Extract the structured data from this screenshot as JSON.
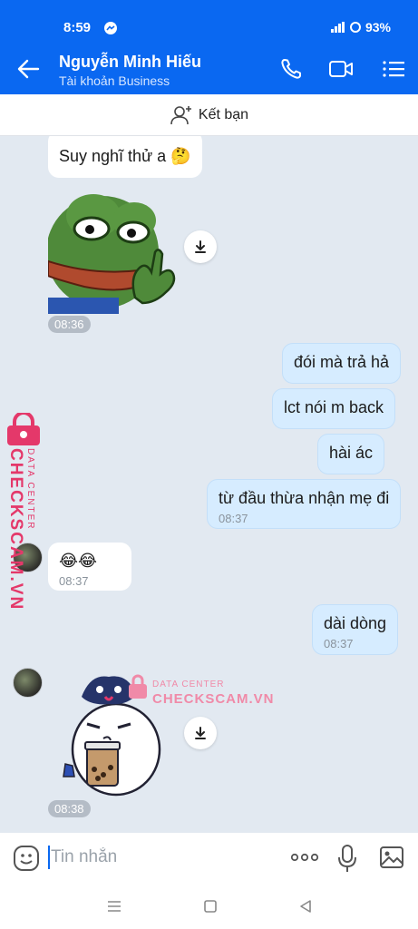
{
  "status": {
    "time": "8:59",
    "battery": "93%"
  },
  "header": {
    "name": "Nguyễn Minh Hiếu",
    "subtitle": "Tài khoản Business"
  },
  "add_friend": {
    "label": "Kết bạn"
  },
  "messages": {
    "m1": {
      "text": "Suy nghĩ thử a 🤔"
    },
    "sticker1": {
      "time": "08:36"
    },
    "m2": {
      "text": "đói mà trả hả"
    },
    "m3": {
      "text": "lct nói m back"
    },
    "m4": {
      "text": "hài ác"
    },
    "m5": {
      "text": "từ đầu thừa nhận mẹ đi",
      "time": "08:37"
    },
    "m6": {
      "text": "😂😂",
      "time": "08:37"
    },
    "m7": {
      "text": "dài dòng",
      "time": "08:37"
    },
    "sticker2": {
      "time": "08:38"
    }
  },
  "watermark": {
    "big": "CHECKSCAM.VN",
    "small": "DATA CENTER"
  },
  "input": {
    "placeholder": "Tin nhắn"
  },
  "colors": {
    "brand": "#0a68f1",
    "out_bubble": "#d6ecff",
    "watermark": "#e4386a"
  }
}
